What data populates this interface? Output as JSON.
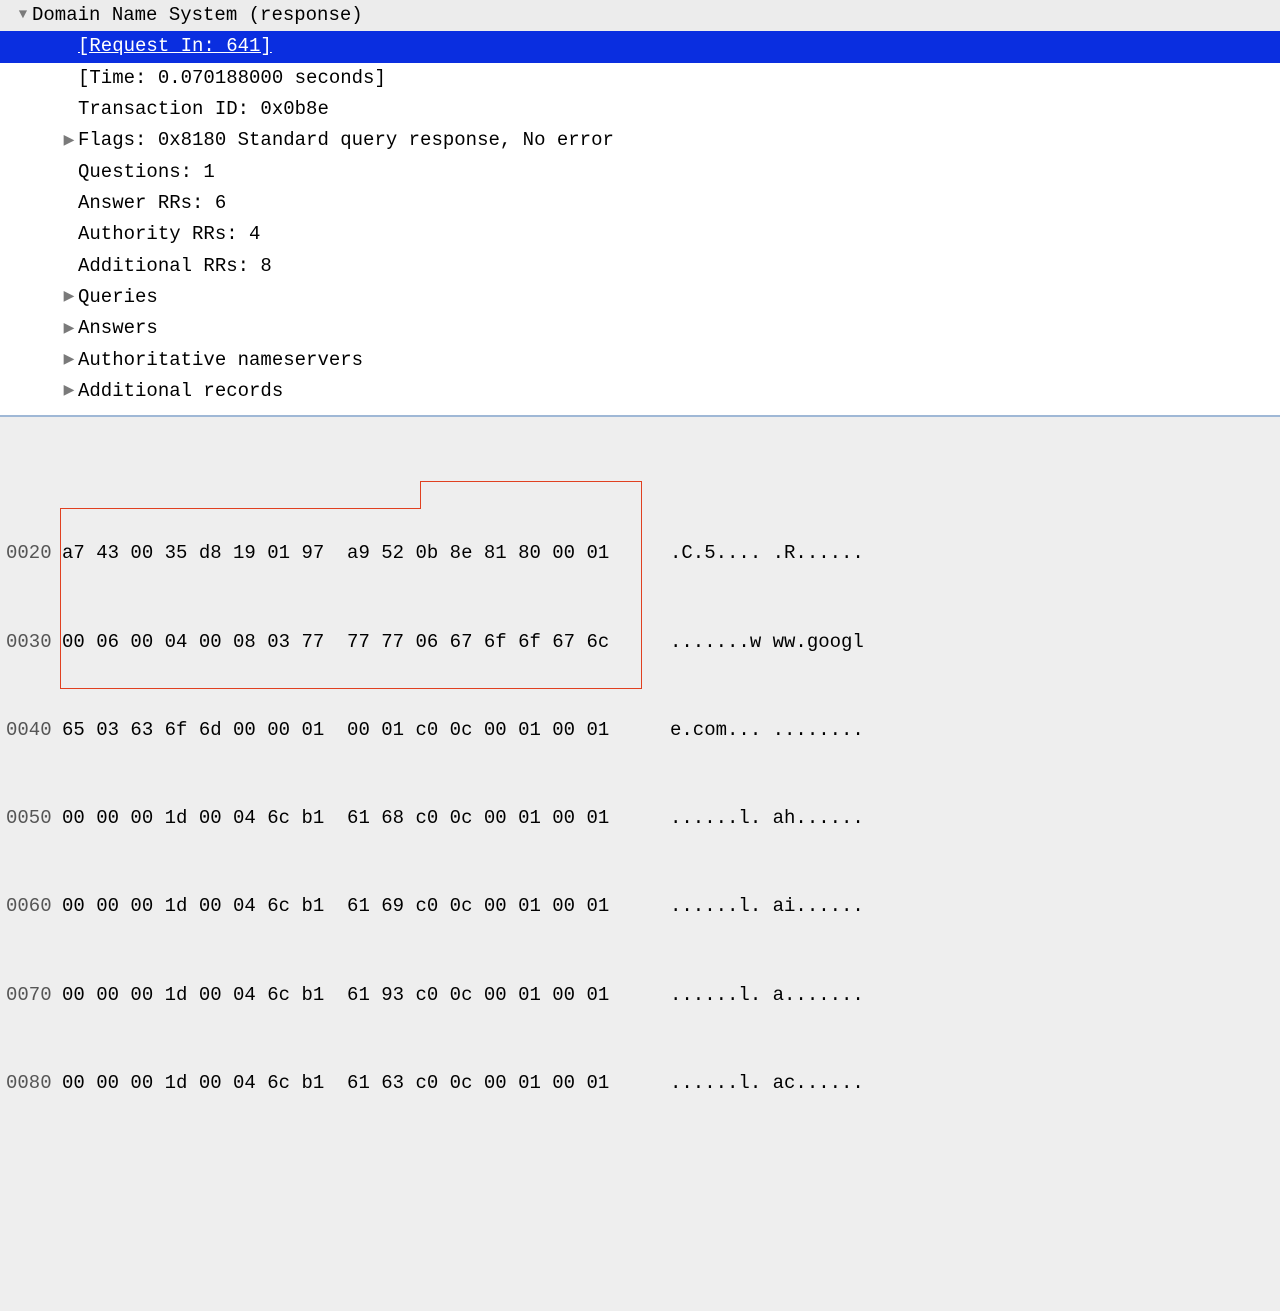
{
  "tree": {
    "header": "Domain Name System (response)",
    "request_in": "[Request In: 641]",
    "time": "[Time: 0.070188000 seconds]",
    "transaction_id": "Transaction ID: 0x0b8e",
    "flags": "Flags: 0x8180 Standard query response, No error",
    "questions": "Questions: 1",
    "answer_rrs": "Answer RRs: 6",
    "authority_rrs": "Authority RRs: 4",
    "additional_rrs": "Additional RRs: 8",
    "queries": "Queries",
    "answers": "Answers",
    "auth_ns": "Authoritative nameservers",
    "add_records": "Additional records"
  },
  "hex": {
    "rows": [
      {
        "offset": "0020",
        "bytes": "a7 43 00 35 d8 19 01 97  a9 52 0b 8e 81 80 00 01",
        "ascii": ".C.5.... .R......"
      },
      {
        "offset": "0030",
        "bytes": "00 06 00 04 00 08 03 77  77 77 06 67 6f 6f 67 6c",
        "ascii": ".......w ww.googl"
      },
      {
        "offset": "0040",
        "bytes": "65 03 63 6f 6d 00 00 01  00 01 c0 0c 00 01 00 01",
        "ascii": "e.com... ........"
      },
      {
        "offset": "0050",
        "bytes": "00 00 00 1d 00 04 6c b1  61 68 c0 0c 00 01 00 01",
        "ascii": "......l. ah......"
      },
      {
        "offset": "0060",
        "bytes": "00 00 00 1d 00 04 6c b1  61 69 c0 0c 00 01 00 01",
        "ascii": "......l. ai......"
      },
      {
        "offset": "0070",
        "bytes": "00 00 00 1d 00 04 6c b1  61 93 c0 0c 00 01 00 01",
        "ascii": "......l. a......."
      },
      {
        "offset": "0080",
        "bytes": "00 00 00 1d 00 04 6c b1  61 63 c0 0c 00 01 00 01",
        "ascii": "......l. ac......"
      }
    ]
  }
}
